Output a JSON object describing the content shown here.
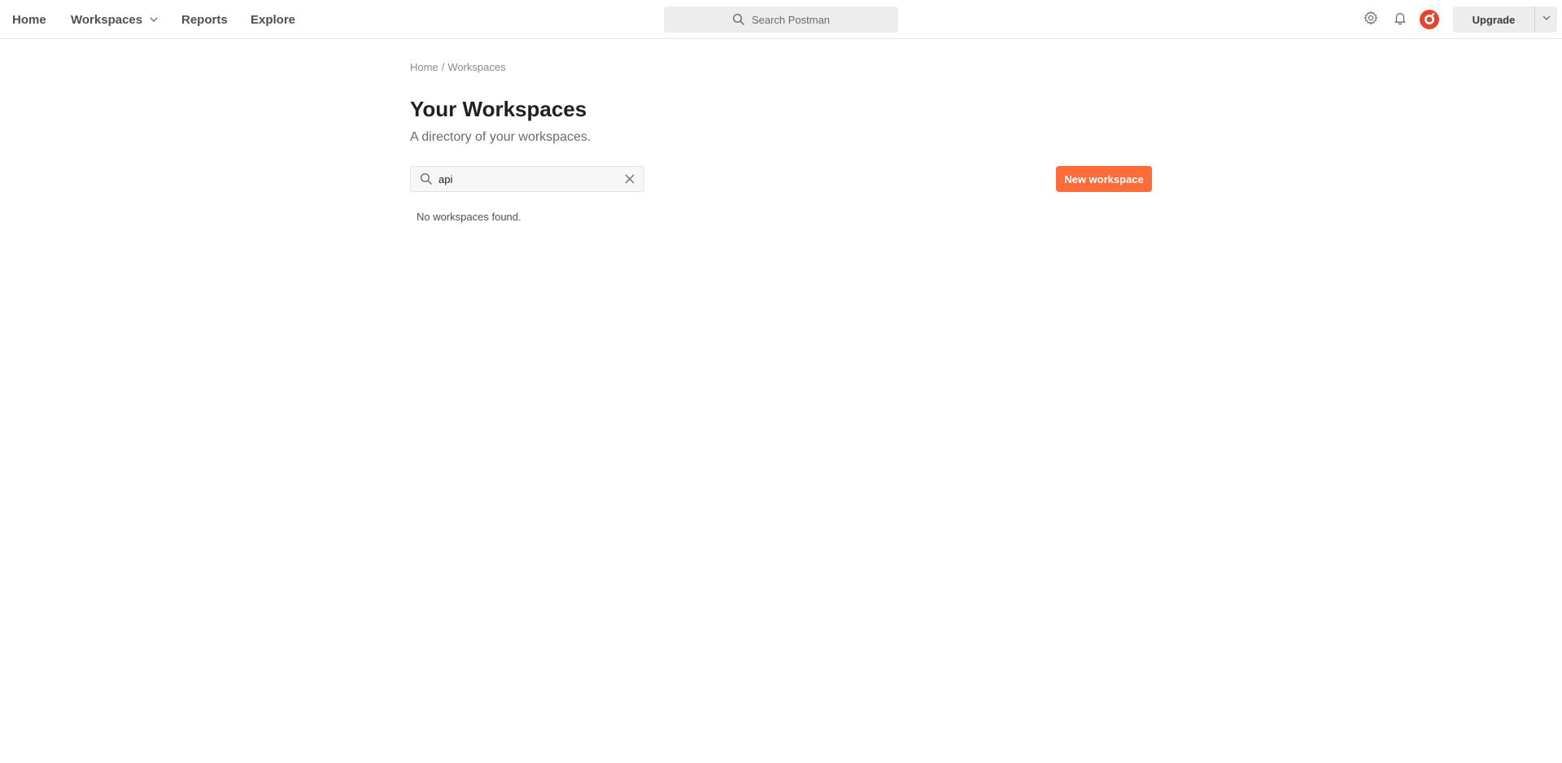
{
  "nav": {
    "home": "Home",
    "workspaces": "Workspaces",
    "reports": "Reports",
    "explore": "Explore"
  },
  "header": {
    "search_placeholder": "Search Postman",
    "upgrade_label": "Upgrade"
  },
  "icons": {
    "search": "search-icon",
    "settings": "gear-icon",
    "notifications": "bell-icon",
    "avatar": "avatar-icon",
    "chevron": "chevron-down-icon",
    "clear": "close-icon"
  },
  "breadcrumb": {
    "home": "Home",
    "separator": "/",
    "current": "Workspaces"
  },
  "page": {
    "title": "Your Workspaces",
    "subtitle": "A directory of your workspaces."
  },
  "filter": {
    "value": "api"
  },
  "actions": {
    "new_workspace": "New workspace"
  },
  "results": {
    "empty_message": "No workspaces found."
  },
  "colors": {
    "accent": "#ff6c37",
    "avatar": "#e8432f"
  }
}
